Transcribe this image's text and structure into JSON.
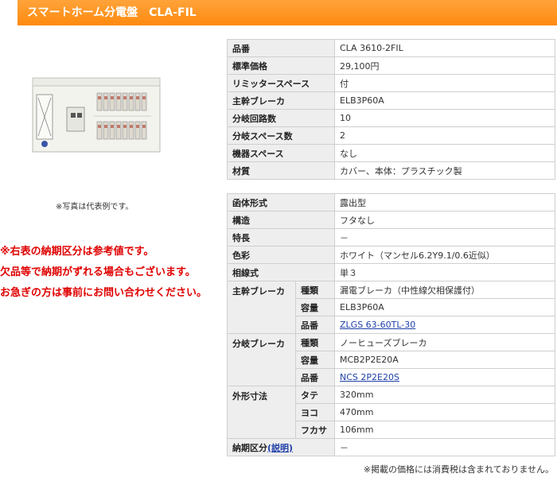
{
  "header": {
    "title": "スマートホーム分電盤　CLA-FIL"
  },
  "photo": {
    "caption": "※写真は代表例です。"
  },
  "notice": {
    "lines": [
      "※右表の納期区分は参考値です。",
      "欠品等で納期がずれる場合もございます。",
      "お急ぎの方は事前にお問い合わせください。"
    ]
  },
  "spec1": [
    {
      "label": "品番",
      "value": "CLA 3610-2FIL"
    },
    {
      "label": "標準価格",
      "value": "29,100円"
    },
    {
      "label": "リミッタースペース",
      "value": "付"
    },
    {
      "label": "主幹ブレーカ",
      "value": "ELB3P60A"
    },
    {
      "label": "分岐回路数",
      "value": "10"
    },
    {
      "label": "分岐スペース数",
      "value": "2"
    },
    {
      "label": "機器スペース",
      "value": "なし"
    },
    {
      "label": "材質",
      "value": "カバー、本体：プラスチック製"
    }
  ],
  "spec2": {
    "housing": {
      "label": "函体形式",
      "value": "露出型"
    },
    "structure": {
      "label": "構造",
      "value": "フタなし"
    },
    "feature": {
      "label": "特長",
      "value": "－"
    },
    "color": {
      "label": "色彩",
      "value": "ホワイト（マンセル6.2Y9.1/0.6近似）"
    },
    "phase": {
      "label": "相線式",
      "value": "単３"
    },
    "main_breaker": {
      "label": "主幹ブレーカ",
      "type_label": "種類",
      "type": "漏電ブレーカ（中性線欠相保護付）",
      "cap_label": "容量",
      "capacity": "ELB3P60A",
      "part_label": "品番",
      "part": "ZLGS 63-60TL-30"
    },
    "branch_breaker": {
      "label": "分岐ブレーカ",
      "type_label": "種類",
      "type": "ノーヒューズブレーカ",
      "cap_label": "容量",
      "capacity": "MCB2P2E20A",
      "part_label": "品番",
      "part": "NCS 2P2E20S"
    },
    "dimensions": {
      "label": "外形寸法",
      "h_label": "タテ",
      "h": "320mm",
      "w_label": "ヨコ",
      "w": "470mm",
      "d_label": "フカサ",
      "d": "106mm"
    },
    "delivery": {
      "label": "納期区分",
      "link": "(説明)",
      "value": "－"
    }
  },
  "footer": {
    "note": "※掲載の価格には消費税は含まれておりません。"
  }
}
